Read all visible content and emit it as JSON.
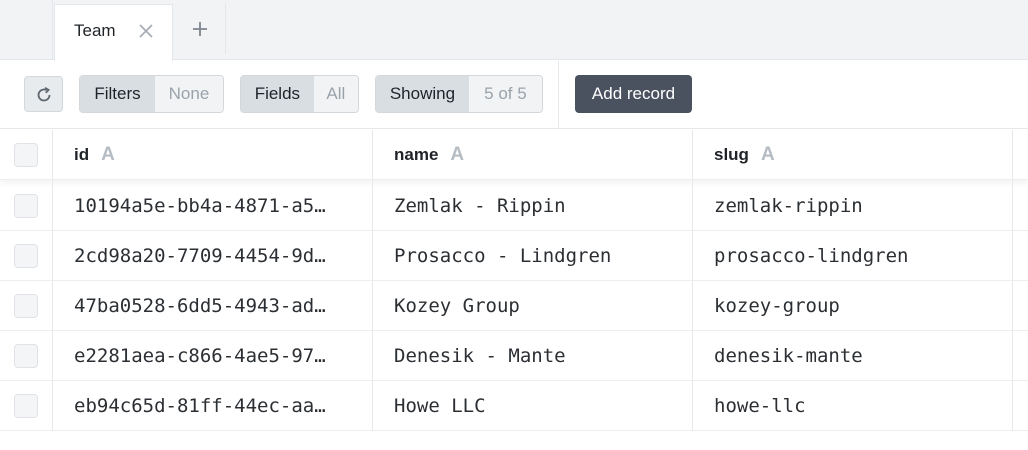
{
  "tabs": [
    {
      "label": "Team",
      "active": true
    }
  ],
  "toolbar": {
    "filters_label": "Filters",
    "filters_value": "None",
    "fields_label": "Fields",
    "fields_value": "All",
    "showing_label": "Showing",
    "showing_value": "5 of 5",
    "add_record_label": "Add record",
    "refresh_icon": "refresh-icon"
  },
  "table": {
    "columns": [
      {
        "label": "id",
        "type_icon": "A"
      },
      {
        "label": "name",
        "type_icon": "A"
      },
      {
        "label": "slug",
        "type_icon": "A"
      }
    ],
    "rows": [
      {
        "id": "10194a5e-bb4a-4871-a5…",
        "name": "Zemlak - Rippin",
        "slug": "zemlak-rippin"
      },
      {
        "id": "2cd98a20-7709-4454-9d…",
        "name": "Prosacco - Lindgren",
        "slug": "prosacco-lindgren"
      },
      {
        "id": "47ba0528-6dd5-4943-ad…",
        "name": "Kozey Group",
        "slug": "kozey-group"
      },
      {
        "id": "e2281aea-c866-4ae5-97…",
        "name": "Denesik - Mante",
        "slug": "denesik-mante"
      },
      {
        "id": "eb94c65d-81ff-44ec-aa…",
        "name": "Howe LLC",
        "slug": "howe-llc"
      }
    ]
  },
  "colors": {
    "accent": "#4a5260",
    "chrome": "#f1f3f5"
  }
}
